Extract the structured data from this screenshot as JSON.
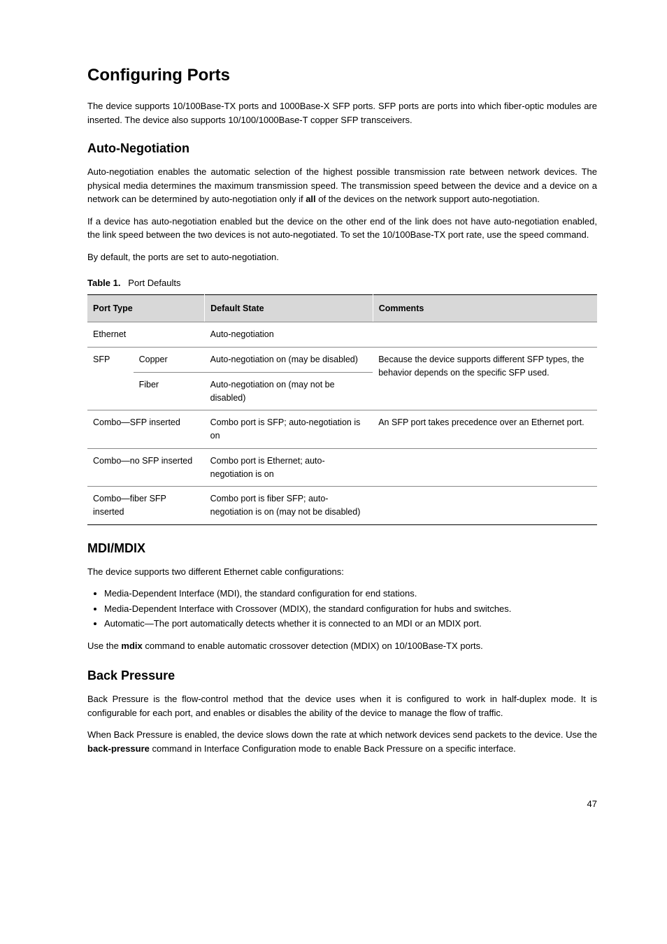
{
  "heading1": "Configuring Ports",
  "intro": "The device supports 10/100Base-TX ports and 1000Base-X SFP ports. SFP ports are ports into which fiber-optic modules are inserted. The device also supports 10/100/1000Base-T copper SFP transceivers.",
  "section_auto_neg": {
    "title": "Auto-Negotiation",
    "p1_prefix": "Auto-negotiation enables the automatic selection of the highest possible transmission rate between network devices. The physical media determines the maximum transmission speed. The transmission speed between the device and a device on a network can be determined by auto-negotiation only if ",
    "p1_bold": "all",
    "p1_suffix": " of the devices on the network support auto-negotiation.",
    "p2": "If a device has auto-negotiation enabled but the device on the other end of the link does not have auto-negotiation enabled, the link speed between the two devices is not auto-negotiated. To set the 10/100Base-TX port rate, use the speed command.",
    "p3": "By default, the ports are set to auto-negotiation.",
    "table_caption_prefix": "Table 1.",
    "table_caption_text": "Port Defaults",
    "headers": [
      "Port Type",
      "Default State",
      "Comments"
    ],
    "rows": [
      {
        "port_type": "Ethernet",
        "default_state": "Auto-negotiation",
        "comments": "",
        "span_cols": 2
      },
      {
        "group": "SFP",
        "sub": "Copper",
        "default_state": "Auto-negotiation on (may be disabled)",
        "comments": "Because the device supports different SFP types, the behavior depends on the specific SFP used.",
        "comments_rowspan": 2
      },
      {
        "group": "",
        "sub": "Fiber",
        "default_state": "Auto-negotiation on (may not be disabled)",
        "comments": ""
      },
      {
        "port_type": "Combo—SFP inserted",
        "default_state": "Combo port is SFP; auto-negotiation is on",
        "comments": "An SFP port takes precedence over an Ethernet port.",
        "span_cols": 2
      },
      {
        "port_type": "Combo—no SFP inserted",
        "default_state": "Combo port is Ethernet; auto-negotiation is on",
        "comments": "",
        "span_cols": 2
      },
      {
        "port_type": "Combo—fiber SFP inserted",
        "default_state": "Combo port is fiber SFP; auto-negotiation is on (may not be disabled)",
        "comments": "",
        "span_cols": 2
      }
    ]
  },
  "section_mdix": {
    "title": "MDI/MDIX",
    "intro": "The device supports two different Ethernet cable configurations:",
    "bullets": [
      "Media-Dependent Interface (MDI), the standard configuration for end stations.",
      "Media-Dependent Interface with Crossover (MDIX), the standard configuration for hubs and switches.",
      "Automatic—The port automatically detects whether it is connected to an MDI or an MDIX port."
    ],
    "p2_prefix": "Use the ",
    "p2_bold": "mdix",
    "p2_suffix": " command to enable automatic crossover detection (MDIX) on 10/100Base-TX ports."
  },
  "section_bp": {
    "title": "Back Pressure",
    "p1": "Back Pressure is the flow-control method that the device uses when it is configured to work in half-duplex mode. It is configurable for each port, and enables or disables the ability of the device to manage the flow of traffic.",
    "p2_prefix": "When Back Pressure is enabled, the device slows down the rate at which network devices send packets to the device. Use the ",
    "p2_bold": "back-pressure",
    "p2_suffix": " command in Interface Configuration mode to enable Back Pressure on a specific interface."
  },
  "page_num": "47"
}
